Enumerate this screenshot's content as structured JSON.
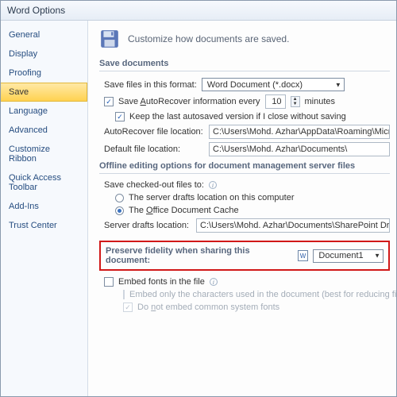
{
  "window": {
    "title": "Word Options"
  },
  "sidebar": {
    "items": [
      {
        "label": "General"
      },
      {
        "label": "Display"
      },
      {
        "label": "Proofing"
      },
      {
        "label": "Save"
      },
      {
        "label": "Language"
      },
      {
        "label": "Advanced"
      },
      {
        "label": "Customize Ribbon"
      },
      {
        "label": "Quick Access Toolbar"
      },
      {
        "label": "Add-Ins"
      },
      {
        "label": "Trust Center"
      }
    ],
    "selected_index": 3
  },
  "main": {
    "heading": "Customize how documents are saved.",
    "save_documents": {
      "title": "Save documents",
      "format_label": "Save files in this format:",
      "format_value": "Word Document (*.docx)",
      "autorecover_prefix": "Save ",
      "autorecover_key": "A",
      "autorecover_mid": "utoRecover information every",
      "autorecover_minutes": "10",
      "autorecover_suffix": "minutes",
      "keep_last_prefix": "Keep the last autosaved version if I close without saving",
      "autorecover_loc_label": "AutoRecover file location:",
      "autorecover_loc_value": "C:\\Users\\Mohd. Azhar\\AppData\\Roaming\\Microsoft\\Word\\",
      "default_loc_label": "Default file location:",
      "default_loc_value": "C:\\Users\\Mohd. Azhar\\Documents\\"
    },
    "offline": {
      "title": "Offline editing options for document management server files",
      "checkout_label": "Save checked-out files to:",
      "opt_server": "The server drafts location on this computer",
      "opt_cache_pre": "The ",
      "opt_cache_key": "O",
      "opt_cache_post": "ffice Document Cache",
      "drafts_label": "Server drafts location:",
      "drafts_value": "C:\\Users\\Mohd. Azhar\\Documents\\SharePoint Drafts\\"
    },
    "fidelity": {
      "title": "Preserve fidelity when sharing this document:",
      "doc_name": "Document1",
      "embed_fonts_pre": "Embed fonts in the file",
      "embed_chars": "Embed only the characters used in the document (best for reducing file size)",
      "embed_common_pre": "Do ",
      "embed_common_key": "n",
      "embed_common_post": "ot embed common system fonts"
    }
  }
}
